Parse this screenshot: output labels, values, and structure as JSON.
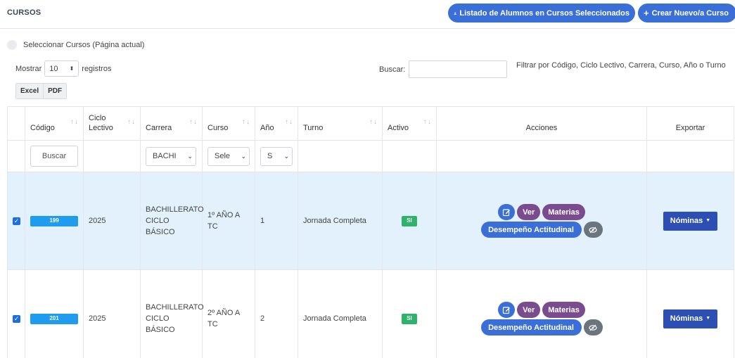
{
  "header": {
    "title": "CURSOS",
    "list_button": "Listado de Alumnos en Cursos Seleccionados",
    "new_button": "Crear Nuevo/a Curso"
  },
  "toolbar": {
    "select_all_label": "Seleccionar Cursos (Página actual)",
    "show_label": "Mostrar",
    "page_size": "10",
    "records_label": "registros",
    "search_label": "Buscar:",
    "search_value": "",
    "filter_hint": "Filtrar por Código, Ciclo Lectivo, Carrera, Curso, Año o Turno",
    "excel_button": "Excel",
    "pdf_button": "PDF"
  },
  "table": {
    "columns": [
      "",
      "Código",
      "Ciclo Lectivo",
      "Carrera",
      "Curso",
      "Año",
      "Turno",
      "Activo",
      "Acciones",
      "Exportar"
    ],
    "filters": {
      "codigo_placeholder": "Buscar",
      "carrera_value": "BACHI",
      "curso_value": "Sele",
      "anio_value": "S"
    },
    "rows": [
      {
        "selected": true,
        "codigo": "199",
        "ciclo": "2025",
        "carrera": "BACHILLERATO CICLO BÁSICO",
        "curso": "1º AÑO A TC",
        "anio": "1",
        "turno": "Jornada Completa",
        "activo": "SI",
        "actions": {
          "ver": "Ver",
          "materias": "Materias",
          "desempeno": "Desempeño Actitudinal"
        },
        "export": "Nóminas"
      },
      {
        "selected": false,
        "codigo": "201",
        "ciclo": "2025",
        "carrera": "BACHILLERATO CICLO BÁSICO",
        "curso": "2º AÑO A TC",
        "anio": "2",
        "turno": "Jornada Completa",
        "activo": "SI",
        "actions": {
          "ver": "Ver",
          "materias": "Materias",
          "desempeno": "Desempeño Actitudinal"
        },
        "export": "Nóminas"
      }
    ]
  },
  "colors": {
    "primary": "#3a6fd8",
    "purple": "#7b4b8f",
    "badge_blue": "#1f9cf0",
    "badge_green": "#2fb36a",
    "nominas": "#2d4fb3",
    "row_selected": "#e2f1fb"
  }
}
